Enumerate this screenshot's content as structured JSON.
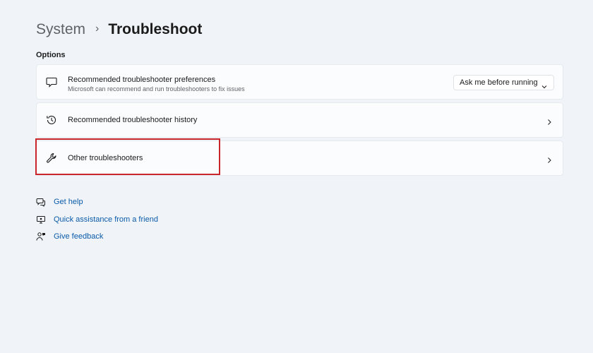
{
  "breadcrumb": {
    "parent": "System",
    "separator": "›",
    "current": "Troubleshoot"
  },
  "section_label": "Options",
  "cards": [
    {
      "title": "Recommended troubleshooter preferences",
      "description": "Microsoft can recommend and run troubleshooters to fix issues",
      "icon": "chat-bubble-icon",
      "dropdown": {
        "selected": "Ask me before running"
      }
    },
    {
      "title": "Recommended troubleshooter history",
      "icon": "history-icon"
    },
    {
      "title": "Other troubleshooters",
      "icon": "wrench-icon"
    }
  ],
  "links": [
    {
      "label": "Get help",
      "icon": "help-chat-icon"
    },
    {
      "label": "Quick assistance from a friend",
      "icon": "monitor-icon"
    },
    {
      "label": "Give feedback",
      "icon": "feedback-icon"
    }
  ],
  "colors": {
    "background": "#f0f4f9",
    "card": "#fbfcfe",
    "link": "#0a5aa8",
    "highlight": "#c8262b"
  }
}
